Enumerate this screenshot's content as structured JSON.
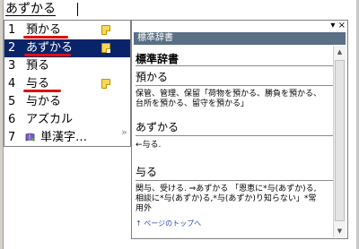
{
  "composition": {
    "text": "あずかる"
  },
  "candidates": [
    {
      "num": "1",
      "text": "預かる",
      "memo": true,
      "underline": true
    },
    {
      "num": "2",
      "text": "あずかる",
      "memo": true,
      "underline": true,
      "selected": true
    },
    {
      "num": "3",
      "text": "預る",
      "memo": false
    },
    {
      "num": "4",
      "text": "与る",
      "memo": true,
      "underline": true
    },
    {
      "num": "5",
      "text": "与かる",
      "memo": false
    },
    {
      "num": "6",
      "text": "アズカル",
      "memo": false
    },
    {
      "num": "7",
      "text": "単漢字…",
      "memo": false,
      "icon": "book-icon"
    }
  ],
  "more_icon": "double-chevron-right-icon",
  "dictionary": {
    "window_controls": "▾ ×",
    "title": "標準辞書",
    "name": "標準辞書",
    "entries": [
      {
        "term": "預かる",
        "definition_lines": [
          "保管、管理、保留「荷物を預かる、勝負を預かる、",
          "台所を預かる、留守を預かる」"
        ]
      },
      {
        "term": "あずかる",
        "definition_lines": [
          "←与る."
        ]
      },
      {
        "term": "与る",
        "definition_lines": [
          "関与、受ける. ⇒あずかる 「恩恵に*与(あずか)る,",
          "相談に*与(あずか)る,*与(あずか)り知らない」*常",
          "用外"
        ]
      }
    ],
    "top_link": "↑ ページのトップへ"
  },
  "colors": {
    "selection": "#0a246a",
    "underline": "#e01010",
    "dict_titlebar": "#5b6f86",
    "link": "#2a4ab0"
  }
}
